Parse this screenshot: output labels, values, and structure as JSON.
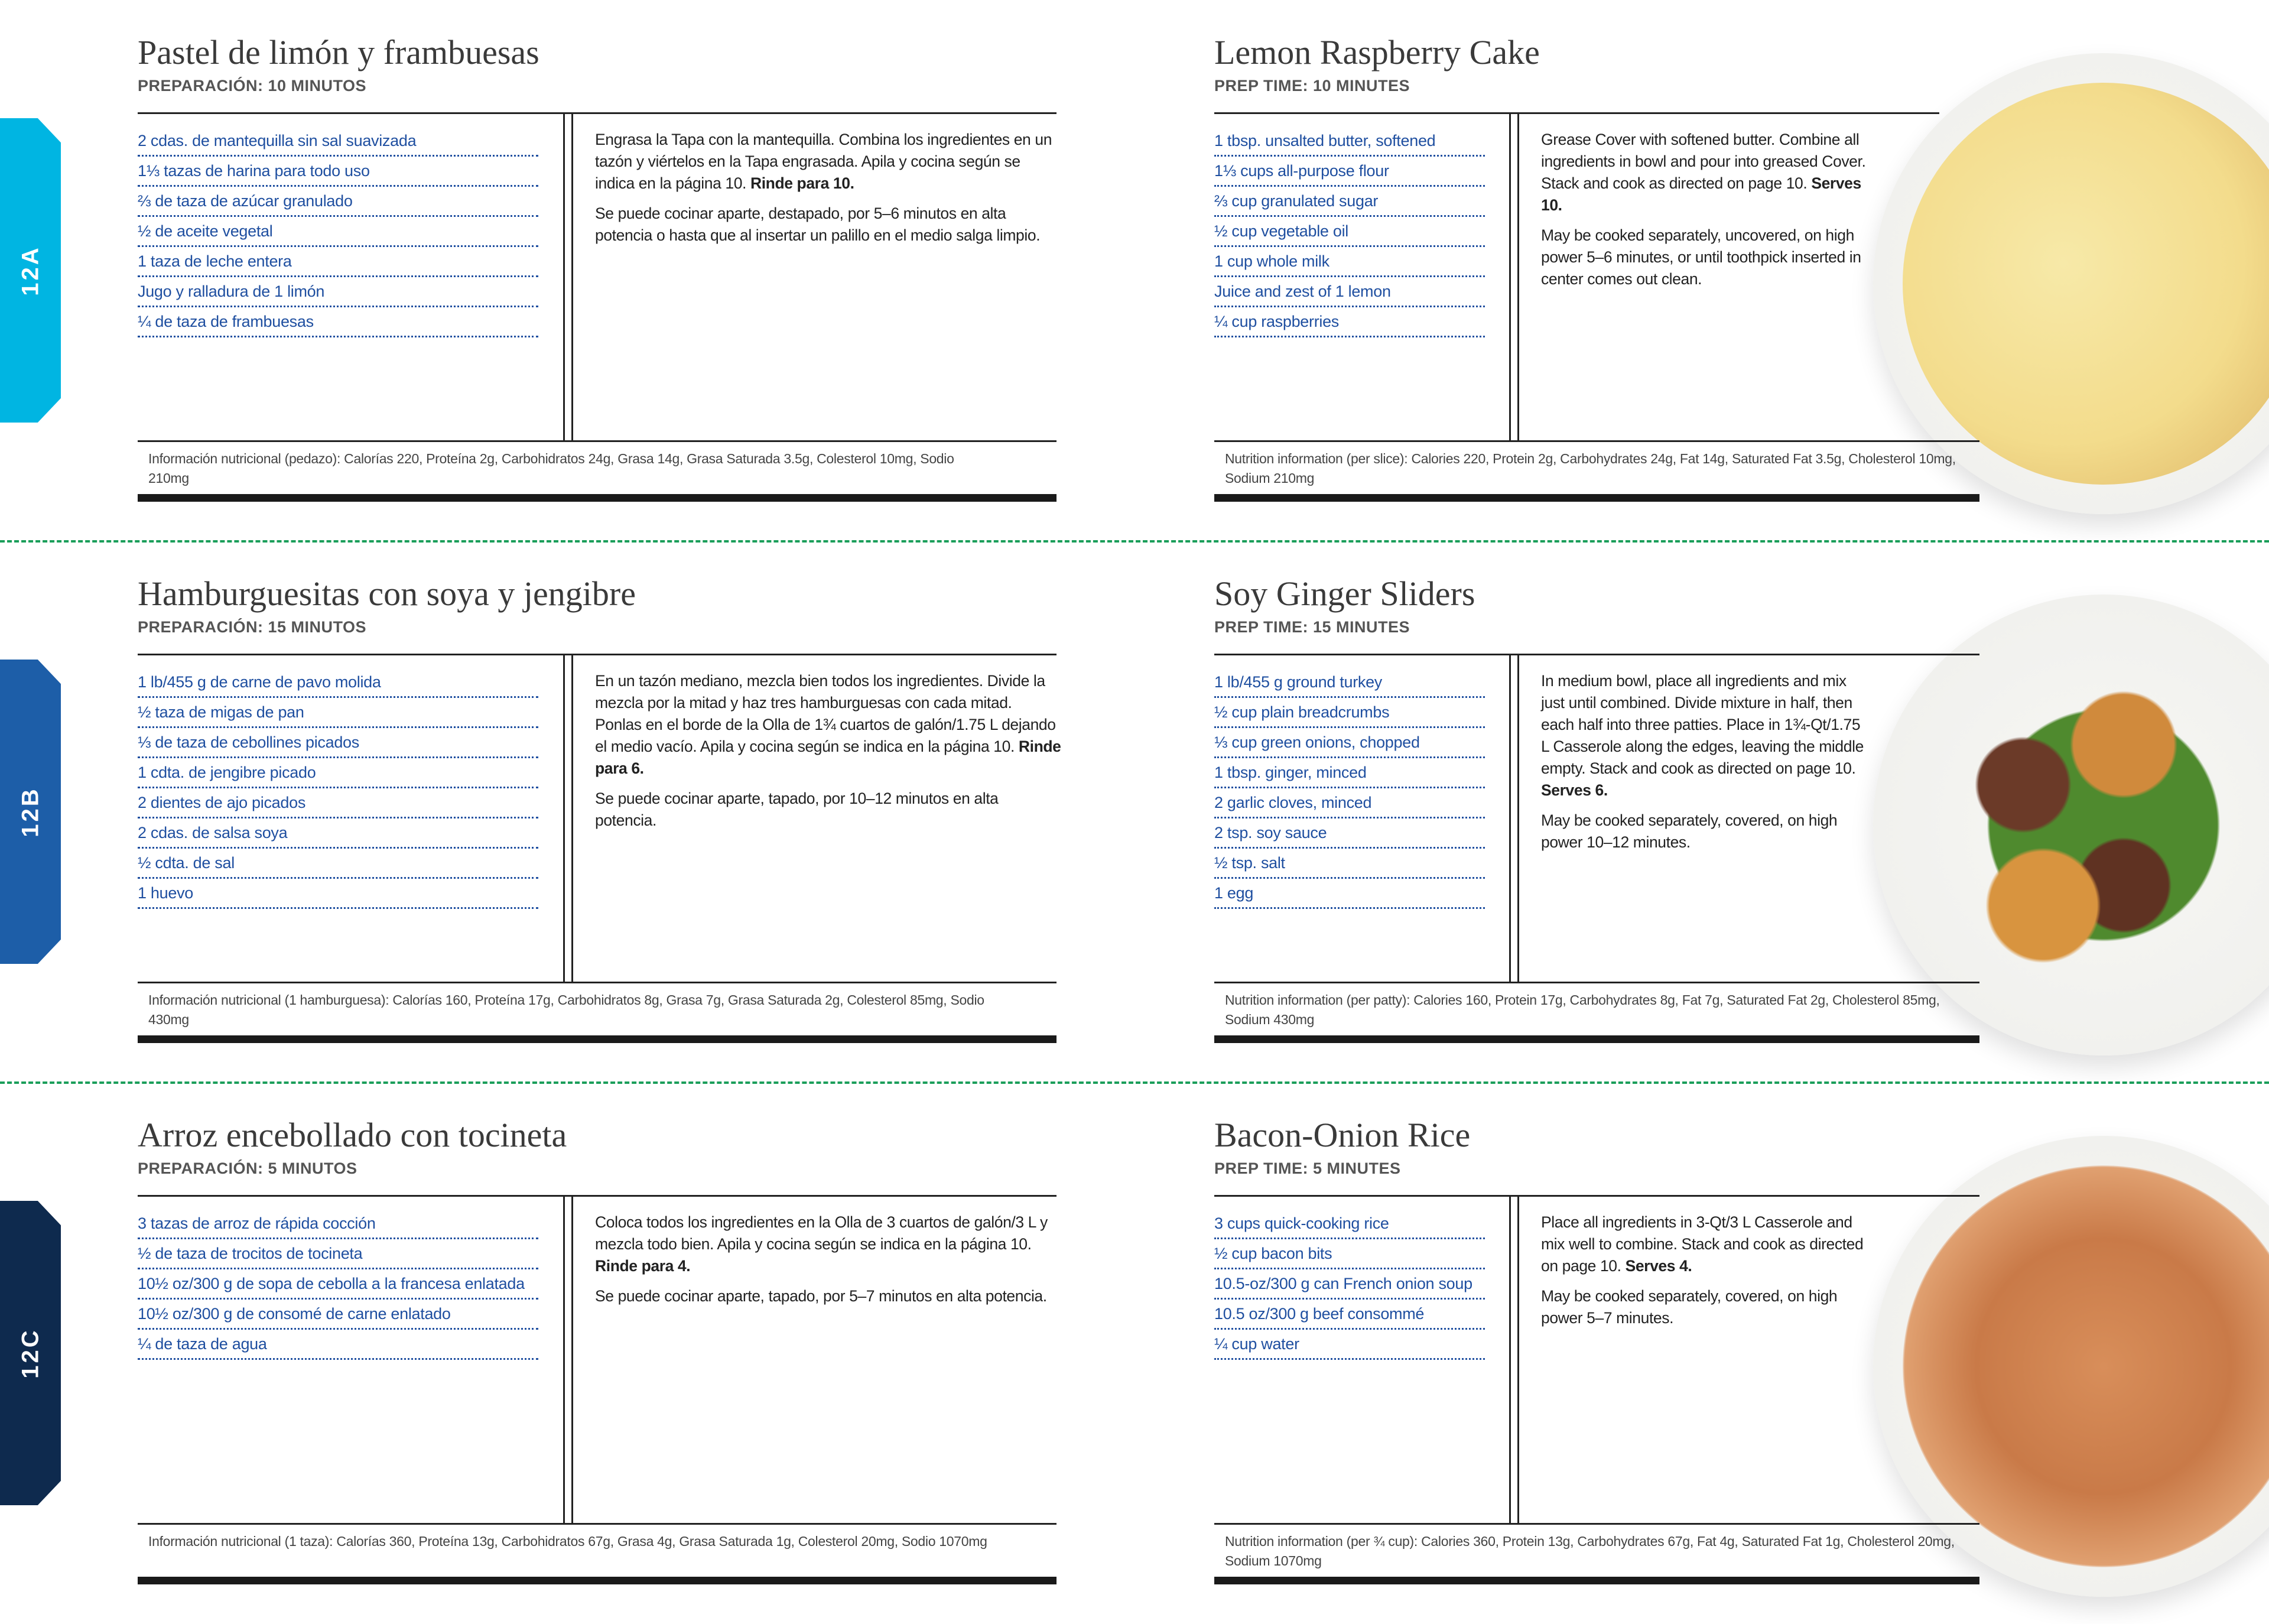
{
  "tabs": [
    {
      "label": "12A",
      "color": "#00b5e2"
    },
    {
      "label": "12B",
      "color": "#1d5ea8"
    },
    {
      "label": "12C",
      "color": "#0e2a4e"
    }
  ],
  "colors": {
    "ingredient": "#1f4fa0",
    "separator": "#1a9e5a",
    "rule": "#222222"
  },
  "recipes": [
    {
      "es": {
        "title": "Pastel de limón y frambuesas",
        "prep": "PREPARACIÓN: 10 MINUTOS",
        "ingredients": [
          "2 cdas. de mantequilla sin sal suavizada",
          "1⅓ tazas de harina para todo uso",
          "⅔ de taza de azúcar granulado",
          "½ de aceite vegetal",
          "1 taza de leche entera",
          "Jugo y ralladura de 1 limón",
          "¼ de taza de frambuesas"
        ],
        "p1": "Engrasa la Tapa con la mantequilla. Combina los ingredientes en un tazón y viértelos en la Tapa engrasada. Apila y cocina según se indica en la página 10. ",
        "p1_bold": "Rinde para 10.",
        "p2": "Se puede cocinar aparte, destapado, por 5–6 minutos en alta potencia o hasta que al insertar un palillo en el medio salga limpio.",
        "nutrition": "Información nutricional (pedazo): Calorías 220, Proteína 2g, Carbohidratos 24g, Grasa 14g, Grasa Saturada 3.5g, Colesterol 10mg, Sodio 210mg"
      },
      "en": {
        "title": "Lemon Raspberry Cake",
        "prep": "PREP TIME: 10 MINUTES",
        "ingredients": [
          "1 tbsp. unsalted butter, softened",
          "1⅓ cups all-purpose flour",
          "⅔ cup granulated sugar",
          "½ cup vegetable oil",
          "1 cup whole milk",
          "Juice and zest of 1 lemon",
          "¼ cup raspberries"
        ],
        "p1": "Grease Cover with softened butter. Combine all ingredients in bowl and pour into greased Cover. Stack and cook as directed on page 10. ",
        "p1_bold": "Serves 10.",
        "p2": "May be cooked separately, uncovered, on high power 5–6 minutes, or until toothpick inserted in center comes out clean.",
        "nutrition": "Nutrition information (per slice): Calories 220, Protein 2g, Carbohydrates 24g, Fat 14g, Saturated Fat 3.5g, Cholesterol 10mg, Sodium 210mg"
      },
      "photo": "lemon-raspberry-cake"
    },
    {
      "es": {
        "title": "Hamburguesitas con soya y jengibre",
        "prep": "PREPARACIÓN: 15 MINUTOS",
        "ingredients": [
          "1 lb/455 g de carne de pavo molida",
          "½ taza de migas de pan",
          "⅓ de taza de cebollines picados",
          "1 cdta. de jengibre picado",
          "2 dientes de ajo picados",
          "2 cdas. de salsa soya",
          "½ cdta. de sal",
          "1 huevo"
        ],
        "p1": "En un tazón mediano, mezcla bien todos los ingredientes. Divide la mezcla por la mitad y haz tres hamburguesas con cada mitad. Ponlas en el borde de la Olla de 1¾ cuartos de galón/1.75 L dejando el medio vacío. Apila y cocina según se indica en la página 10. ",
        "p1_bold": "Rinde para 6.",
        "p2": "Se puede cocinar aparte, tapado, por 10–12 minutos en alta potencia.",
        "nutrition": "Información nutricional (1 hamburguesa): Calorías 160, Proteína 17g, Carbohidratos 8g, Grasa 7g, Grasa Saturada 2g, Colesterol 85mg, Sodio 430mg"
      },
      "en": {
        "title": "Soy Ginger Sliders",
        "prep": "PREP TIME: 15 MINUTES",
        "ingredients": [
          "1 lb/455 g ground turkey",
          "½ cup plain breadcrumbs",
          "⅓ cup green onions, chopped",
          "1 tbsp. ginger, minced",
          "2 garlic cloves, minced",
          "2 tsp. soy sauce",
          "½ tsp. salt",
          "1 egg"
        ],
        "p1": "In medium bowl, place all ingredients and mix just until combined. Divide mixture in half, then each half into three patties. Place in 1¾-Qt/1.75 L Casserole along the edges, leaving the middle empty. Stack and cook as directed on page 10. ",
        "p1_bold": "Serves 6.",
        "p2": "May be cooked separately, covered, on high power 10–12 minutes.",
        "nutrition": "Nutrition information (per patty): Calories 160, Protein 17g, Carbohydrates 8g, Fat 7g, Saturated Fat 2g, Cholesterol 85mg, Sodium 430mg"
      },
      "photo": "soy-ginger-sliders"
    },
    {
      "es": {
        "title": "Arroz encebollado con tocineta",
        "prep": "PREPARACIÓN: 5 MINUTOS",
        "ingredients": [
          "3 tazas de arroz de rápida cocción",
          "½ de taza de trocitos de tocineta",
          "10½ oz/300 g de sopa de cebolla a la francesa enlatada",
          "10½ oz/300 g de consomé de carne enlatado",
          "¼ de taza de agua"
        ],
        "p1": "Coloca todos los ingredientes en la Olla de 3 cuartos de galón/3 L y mezcla todo bien. Apila y cocina según se indica en la página 10. ",
        "p1_bold": "Rinde para 4.",
        "p2": "Se puede cocinar aparte, tapado, por 5–7 minutos en alta potencia.",
        "nutrition": "Información nutricional (1 taza): Calorías 360, Proteína 13g, Carbohidratos 67g, Grasa 4g, Grasa Saturada 1g, Colesterol 20mg, Sodio 1070mg"
      },
      "en": {
        "title": "Bacon-Onion Rice",
        "prep": "PREP TIME: 5 MINUTES",
        "ingredients": [
          "3 cups quick-cooking rice",
          "½ cup bacon bits",
          "10.5-oz/300 g can French onion soup",
          "10.5 oz/300 g beef consommé",
          "¼ cup water"
        ],
        "p1": "Place all ingredients in 3-Qt/3 L Casserole and mix well to combine. Stack and cook as directed on page 10. ",
        "p1_bold": "Serves 4.",
        "p2": "May be cooked separately, covered, on high power 5–7 minutes.",
        "nutrition": "Nutrition information (per ¾ cup): Calories 360, Protein 13g, Carbohydrates 67g, Fat 4g, Saturated Fat 1g, Cholesterol 20mg, Sodium 1070mg"
      },
      "photo": "bacon-onion-rice"
    }
  ]
}
